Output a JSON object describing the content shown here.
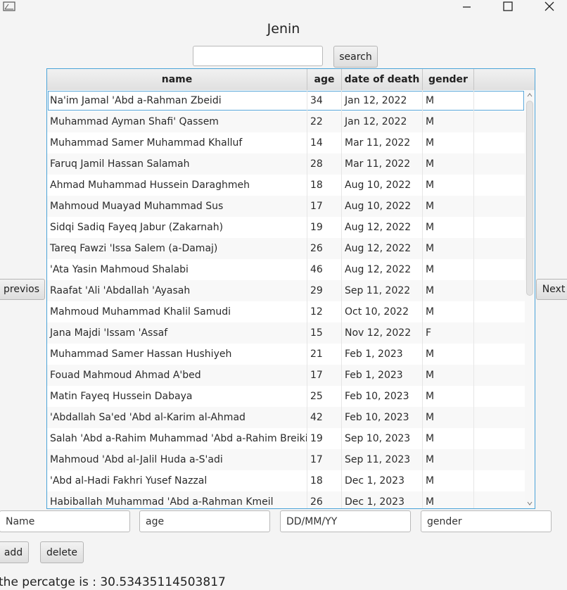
{
  "window": {
    "title": "Jenin",
    "controls": {
      "minimize_icon": "minimize-icon",
      "maximize_icon": "maximize-icon",
      "close_icon": "close-icon"
    }
  },
  "search": {
    "value": "",
    "button_label": "search"
  },
  "table": {
    "columns": [
      "name",
      "age",
      "date of death",
      "gender"
    ],
    "rows": [
      [
        "Na'im Jamal 'Abd a-Rahman Zbeidi",
        "34",
        "Jan 12, 2022",
        "M"
      ],
      [
        "Muhammad Ayman Shafi' Qassem",
        "22",
        "Jan 12, 2022",
        "M"
      ],
      [
        "Muhammad Samer Muhammad Khalluf",
        "14",
        "Mar 11, 2022",
        "M"
      ],
      [
        "Faruq Jamil Hassan Salamah",
        "28",
        "Mar 11, 2022",
        "M"
      ],
      [
        "Ahmad Muhammad Hussein Daraghmeh",
        "18",
        "Aug 10, 2022",
        "M"
      ],
      [
        "Mahmoud Muayad Muhammad Sus",
        "17",
        "Aug 10, 2022",
        "M"
      ],
      [
        "Sidqi Sadiq Fayeq Jabur (Zakarnah)",
        "19",
        "Aug 12, 2022",
        "M"
      ],
      [
        "Tareq Fawzi 'Issa Salem (a-Damaj)",
        "26",
        "Aug 12, 2022",
        "M"
      ],
      [
        "'Ata Yasin Mahmoud Shalabi",
        "46",
        "Aug 12, 2022",
        "M"
      ],
      [
        "Raafat 'Ali 'Abdallah 'Ayasah",
        "29",
        "Sep 11, 2022",
        "M"
      ],
      [
        "Mahmoud Muhammad Khalil Samudi",
        "12",
        "Oct 10, 2022",
        "M"
      ],
      [
        "Jana Majdi 'Issam 'Assaf",
        "15",
        "Nov 12, 2022",
        "F"
      ],
      [
        "Muhammad Samer Hassan Hushiyeh",
        "21",
        "Feb 1, 2023",
        "M"
      ],
      [
        "Fouad Mahmoud Ahmad A'bed",
        "17",
        "Feb 1, 2023",
        "M"
      ],
      [
        "Matin Fayeq Hussein Dabaya",
        "25",
        "Feb 10, 2023",
        "M"
      ],
      [
        "'Abdallah Sa'ed 'Abd al-Karim al-Ahmad",
        "42",
        "Feb 10, 2023",
        "M"
      ],
      [
        "Salah 'Abd a-Rahim Muhammad 'Abd a-Rahim Breiki",
        "19",
        "Sep 10, 2023",
        "M"
      ],
      [
        "Mahmoud 'Abd al-Jalil Huda a-S'adi",
        "17",
        "Sep 11, 2023",
        "M"
      ],
      [
        "'Abd al-Hadi Fakhri Yusef Nazzal",
        "18",
        "Dec 1, 2023",
        "M"
      ],
      [
        "Habiballah Muhammad 'Abd a-Rahman Kmeil",
        "26",
        "Dec 1, 2023",
        "M"
      ]
    ],
    "selected_row_index": 0
  },
  "nav": {
    "previous_label": "previos",
    "next_label": "Next"
  },
  "form": {
    "name_placeholder": "Name",
    "age_placeholder": "age",
    "date_placeholder": "DD/MM/YY",
    "gender_placeholder": "gender"
  },
  "actions": {
    "add_label": "add",
    "delete_label": "delete"
  },
  "status": {
    "percentage_text": "the percatge is : 30.53435114503817"
  },
  "colors": {
    "accent": "#4aa3d8",
    "background": "#f4f4f4",
    "row_alt": "#f8f8f8"
  }
}
